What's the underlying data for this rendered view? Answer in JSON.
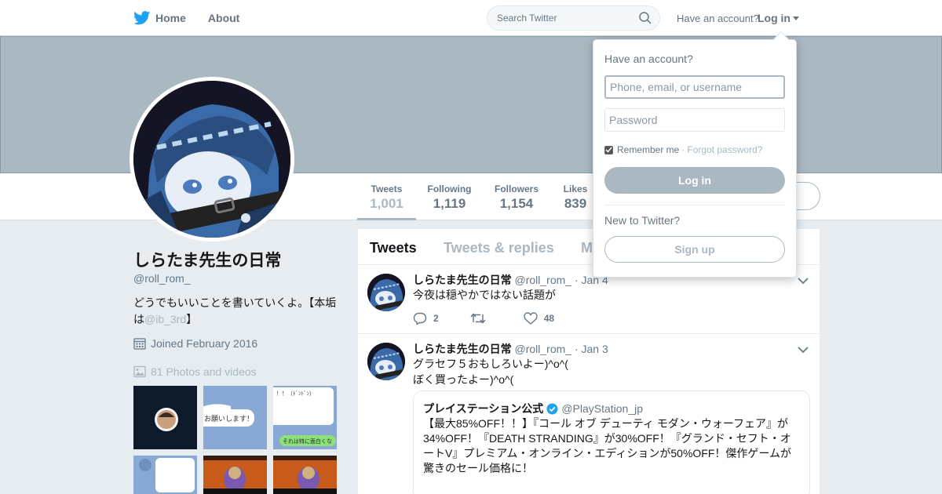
{
  "colors": {
    "brand": "#1da1f2",
    "muted_accent": "#aab8c2",
    "text_secondary": "#657786",
    "background": "#e6ecf0"
  },
  "topnav": {
    "home_label": "Home",
    "about_label": "About",
    "search_placeholder": "Search Twitter",
    "have_account_text": "Have an account?",
    "login_label": "Log in"
  },
  "profile_nav": {
    "stats": [
      {
        "label": "Tweets",
        "value": "1,001"
      },
      {
        "label": "Following",
        "value": "1,119"
      },
      {
        "label": "Followers",
        "value": "1,154"
      },
      {
        "label": "Likes",
        "value": "839"
      }
    ]
  },
  "profile": {
    "name": "しらたま先生の日常",
    "handle": "@roll_rom_",
    "bio_text": "どうでもいいことを書いていくよ。【本垢は",
    "bio_link": "@ib_3rd",
    "bio_end": "】",
    "joined": "Joined February 2016",
    "photos_link": "81 Photos and videos"
  },
  "timeline": {
    "tabs": [
      "Tweets",
      "Tweets & replies",
      "M"
    ],
    "tweets": [
      {
        "name": "しらたま先生の日常",
        "handle": "@roll_rom_",
        "date": "· Jan 4",
        "text": "今夜は穏やかではない話題が",
        "replies": "2",
        "retweets": "",
        "likes": "48"
      },
      {
        "name": "しらたま先生の日常",
        "handle": "@roll_rom_",
        "date": "· Jan 3",
        "text_line1": "グラセフ５おもしろいよー)^o^(",
        "text_line2": "ぼく買ったよー)^o^(",
        "quote": {
          "name": "プレイステーション公式",
          "handle": "@PlayStation_jp",
          "text": "【最大85%OFF！！】『コール オブ デューティ モダン・ウォーフェア』が34%OFF！『DEATH STRANDING』が30%OFF！『グランド・セフト・オートV』プレミアム・オンライン・エディションが50%OFF！傑作ゲームが驚きのセール価格に！"
        }
      }
    ]
  },
  "login_dropdown": {
    "title": "Have an account?",
    "username_placeholder": "Phone, email, or username",
    "password_placeholder": "Password",
    "remember_label": "Remember me",
    "separator": "·",
    "forgot_label": "Forgot password?",
    "login_button": "Log in",
    "new_to_twitter": "New to Twitter?",
    "signup_button": "Sign up"
  },
  "thumbnail_texts": {
    "t2": "お願いします！",
    "t3a": "！！（ﾄﾞﾝﾄﾞﾝ）",
    "t3b": "それは特に面白くな"
  }
}
